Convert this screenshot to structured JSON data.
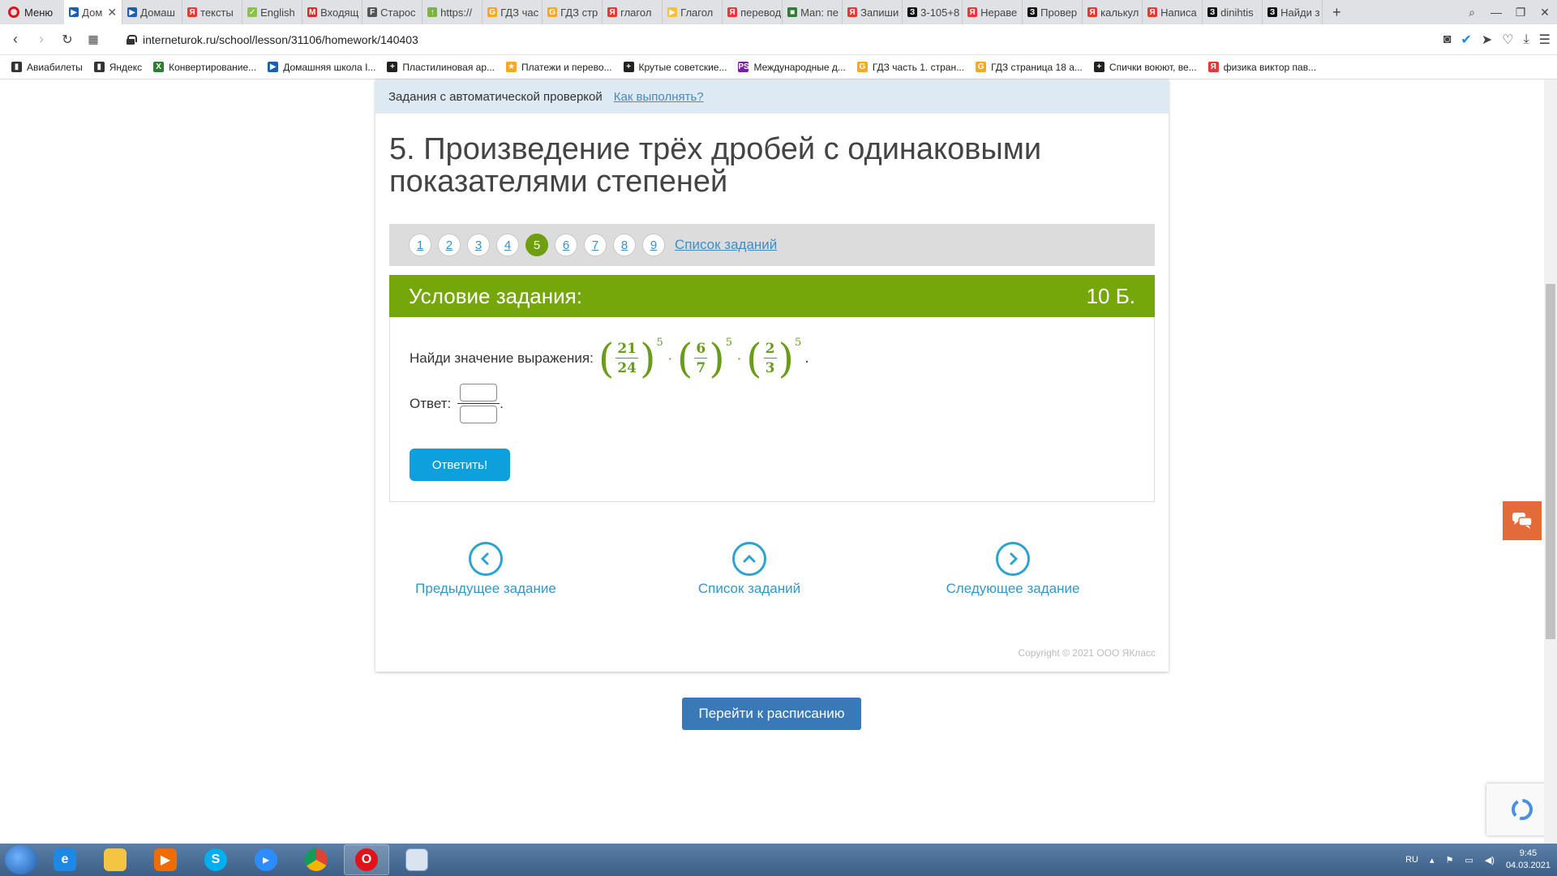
{
  "browser": {
    "menu_label": "Меню",
    "tabs": [
      {
        "label": "Дом",
        "color": "#1a5fb4",
        "glyph": "▶",
        "active": true
      },
      {
        "label": "Домаш",
        "color": "#1a5fb4",
        "glyph": "▶"
      },
      {
        "label": "тексты",
        "color": "#e53935",
        "glyph": "Я"
      },
      {
        "label": "English",
        "color": "#8bc34a",
        "glyph": "✓"
      },
      {
        "label": "Входящ",
        "color": "#d32f2f",
        "glyph": "M"
      },
      {
        "label": "Старос",
        "color": "#555555",
        "glyph": "F"
      },
      {
        "label": "https://",
        "color": "#7cb342",
        "glyph": "↑"
      },
      {
        "label": "ГДЗ час",
        "color": "#f9a825",
        "glyph": "G"
      },
      {
        "label": "ГДЗ стр",
        "color": "#f9a825",
        "glyph": "G"
      },
      {
        "label": "глагол",
        "color": "#e53935",
        "glyph": "Я"
      },
      {
        "label": "Глагол",
        "color": "#fbc02d",
        "glyph": "▶"
      },
      {
        "label": "перевод",
        "color": "#e53935",
        "glyph": "Я"
      },
      {
        "label": "Man: пе",
        "color": "#2e7d32",
        "glyph": "■"
      },
      {
        "label": "Запиши",
        "color": "#e53935",
        "glyph": "Я"
      },
      {
        "label": "3-105+8",
        "color": "#111111",
        "glyph": "З"
      },
      {
        "label": "Нераве",
        "color": "#e53935",
        "glyph": "Я"
      },
      {
        "label": "Провер",
        "color": "#111111",
        "glyph": "З"
      },
      {
        "label": "калькул",
        "color": "#e53935",
        "glyph": "Я"
      },
      {
        "label": "Написа",
        "color": "#e53935",
        "glyph": "Я"
      },
      {
        "label": "dinihtis",
        "color": "#111111",
        "glyph": "З"
      },
      {
        "label": "Найди з",
        "color": "#111111",
        "glyph": "З"
      }
    ],
    "url": "interneturok.ru/school/lesson/31106/homework/140403",
    "bookmarks": [
      {
        "label": "Авиабилеты",
        "color": "#333333",
        "glyph": "▮"
      },
      {
        "label": "Яндекс",
        "color": "#333333",
        "glyph": "▮"
      },
      {
        "label": "Конвертирование...",
        "color": "#2e7d32",
        "glyph": "X"
      },
      {
        "label": "Домашняя школа I...",
        "color": "#1a5fb4",
        "glyph": "▶"
      },
      {
        "label": "Пластилиновая ар...",
        "color": "#222222",
        "glyph": "+"
      },
      {
        "label": "Платежи и перево...",
        "color": "#f9a825",
        "glyph": "★"
      },
      {
        "label": "Крутые советские...",
        "color": "#222222",
        "glyph": "+"
      },
      {
        "label": "Международные д...",
        "color": "#7b1fa2",
        "glyph": "PS"
      },
      {
        "label": "ГДЗ часть 1. стран...",
        "color": "#f9a825",
        "glyph": "G"
      },
      {
        "label": "ГДЗ страница 18 а...",
        "color": "#f9a825",
        "glyph": "G"
      },
      {
        "label": "Спички воюют, ве...",
        "color": "#222222",
        "glyph": "+"
      },
      {
        "label": "физика виктор пав...",
        "color": "#e53935",
        "glyph": "Я"
      }
    ]
  },
  "page": {
    "auto_check_text": "Задания с автоматической проверкой",
    "how_to_link": "Как выполнять?",
    "lesson_title": "5. Произведение трёх дробей с одинаковыми показателями степеней",
    "steps": [
      "1",
      "2",
      "3",
      "4",
      "5",
      "6",
      "7",
      "8",
      "9"
    ],
    "current_step": "5",
    "task_list_link": "Список заданий",
    "condition_header": "Условие задания:",
    "points": "10 Б.",
    "question_prefix": "Найди значение выражения:",
    "expression": {
      "fractions": [
        {
          "num": "21",
          "den": "24",
          "power": "5"
        },
        {
          "num": "6",
          "den": "7",
          "power": "5"
        },
        {
          "num": "2",
          "den": "3",
          "power": "5"
        }
      ],
      "operator": "·",
      "end": "."
    },
    "answer_label": "Ответ:",
    "answer_numerator": "",
    "answer_denominator": "",
    "answer_end": ".",
    "submit_label": "Ответить!",
    "prev_task": "Предыдущее задание",
    "task_list": "Список заданий",
    "next_task": "Следующее задание",
    "copyright": "Copyright © 2021 ООО ЯКласс",
    "schedule_button": "Перейти к расписанию"
  },
  "taskbar": {
    "language": "RU",
    "time": "9:45",
    "date": "04.03.2021"
  },
  "colors": {
    "accent_green": "#76a70a",
    "link_blue": "#3b8fc7",
    "submit_blue": "#0ea0dc",
    "schedule_blue": "#3a79b8"
  }
}
